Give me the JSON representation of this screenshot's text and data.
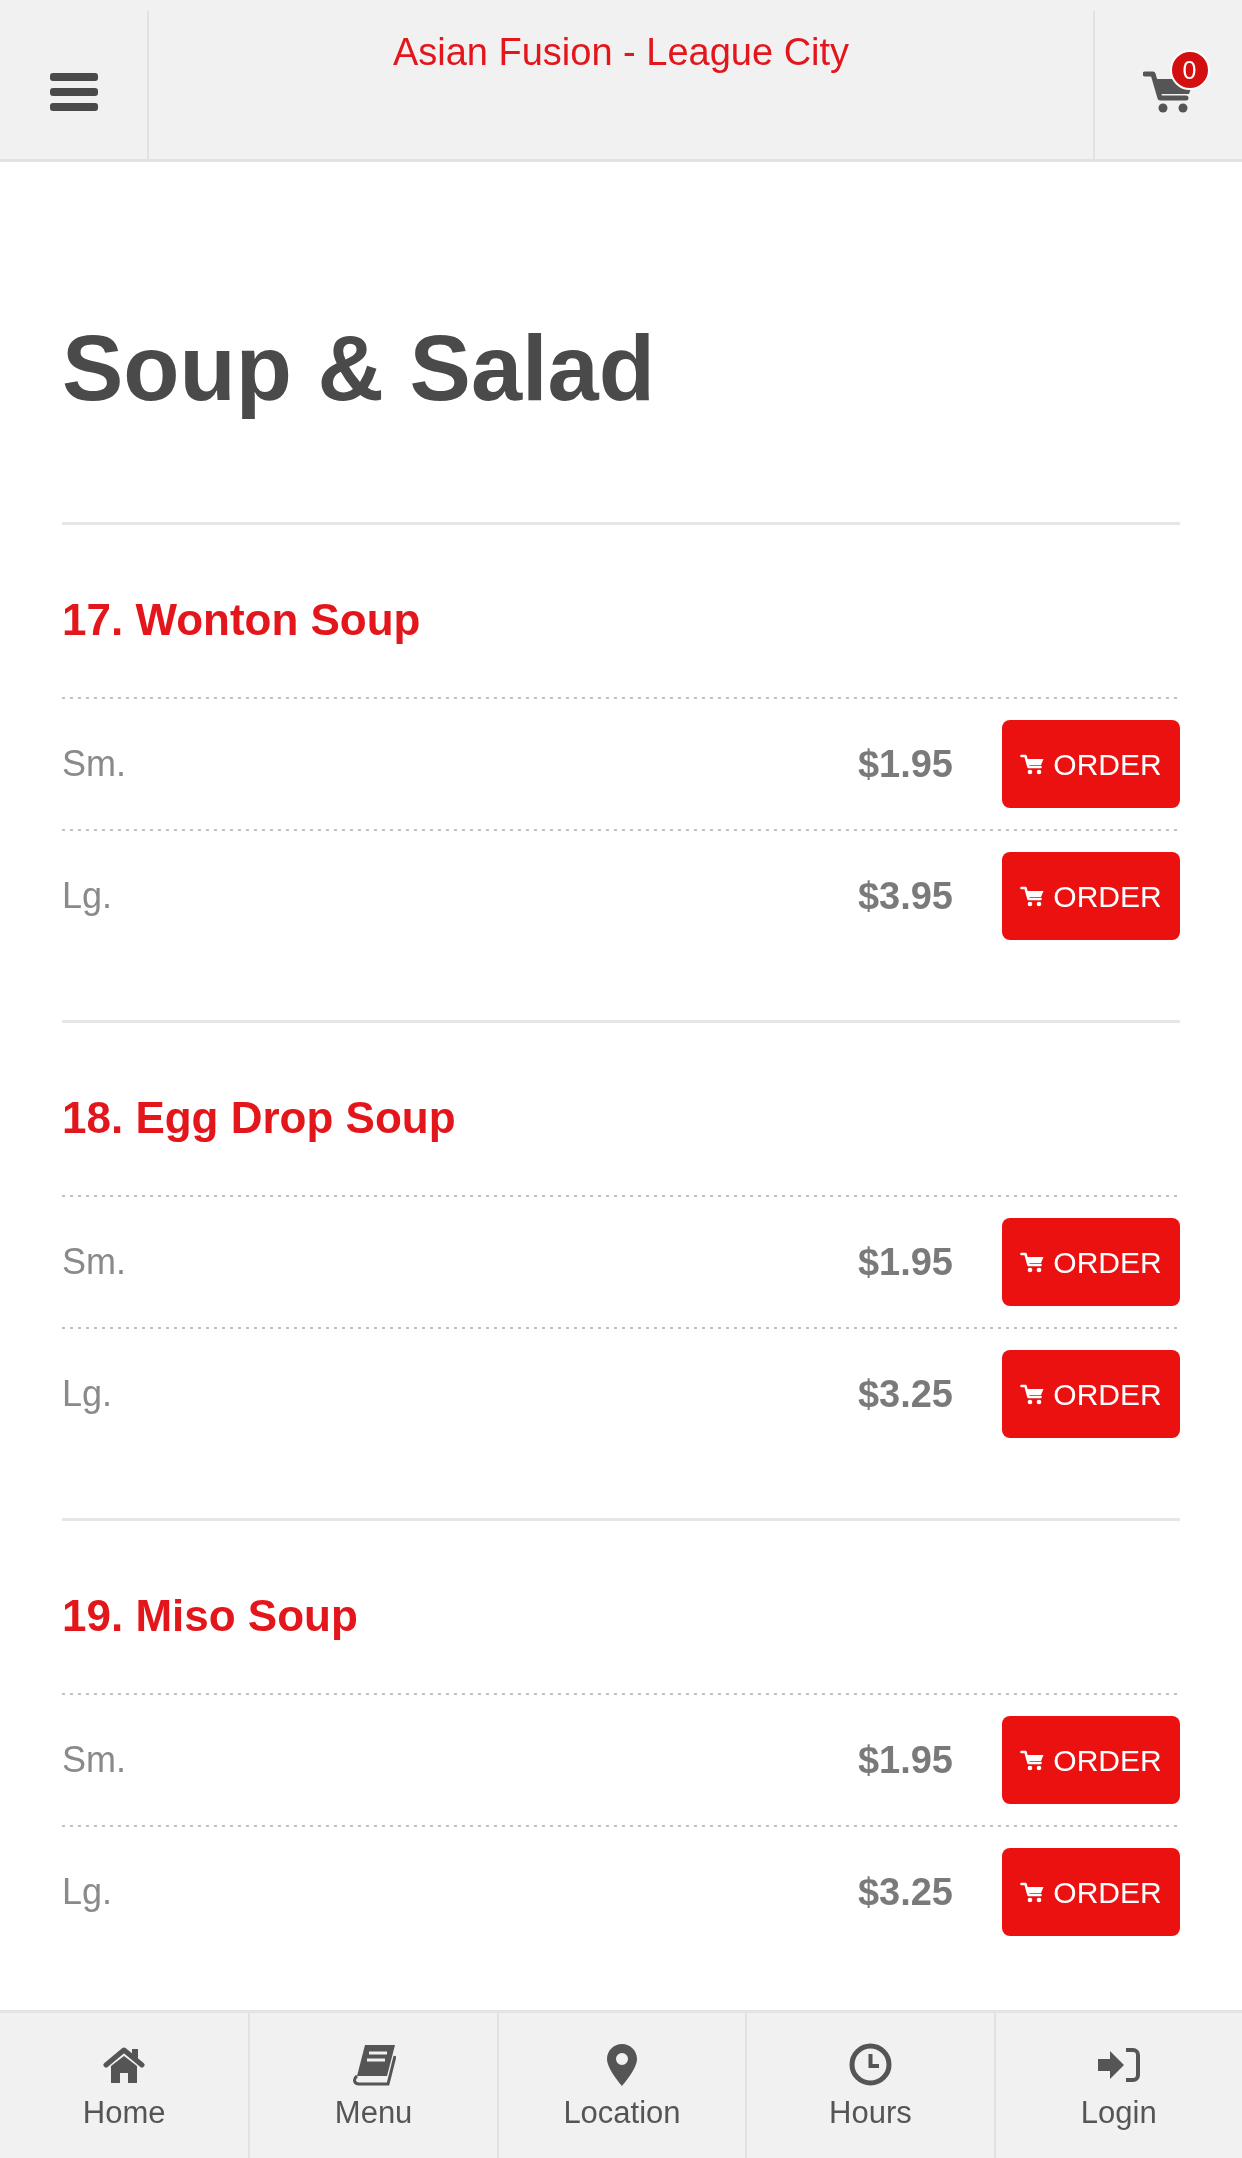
{
  "header": {
    "title": "Asian Fusion - League City",
    "cart_count": "0"
  },
  "page_title": "Soup & Salad",
  "items": [
    {
      "name": "17. Wonton Soup",
      "options": [
        {
          "size": "Sm.",
          "price": "$1.95",
          "button": "ORDER"
        },
        {
          "size": "Lg.",
          "price": "$3.95",
          "button": "ORDER"
        }
      ]
    },
    {
      "name": "18. Egg Drop Soup",
      "options": [
        {
          "size": "Sm.",
          "price": "$1.95",
          "button": "ORDER"
        },
        {
          "size": "Lg.",
          "price": "$3.25",
          "button": "ORDER"
        }
      ]
    },
    {
      "name": "19. Miso Soup",
      "options": [
        {
          "size": "Sm.",
          "price": "$1.95",
          "button": "ORDER"
        },
        {
          "size": "Lg.",
          "price": "$3.25",
          "button": "ORDER"
        }
      ]
    }
  ],
  "bottom_nav": [
    {
      "label": "Home"
    },
    {
      "label": "Menu"
    },
    {
      "label": "Location"
    },
    {
      "label": "Hours"
    },
    {
      "label": "Login"
    }
  ]
}
